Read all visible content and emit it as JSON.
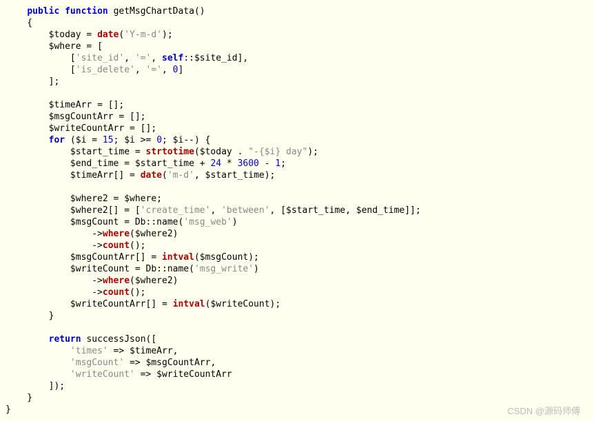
{
  "code": {
    "sig": {
      "public": "public",
      "function": "function",
      "name": "getMsgChartData"
    },
    "today": {
      "var": "$today",
      "date": "date",
      "fmt": "'Y-m-d'"
    },
    "whereAssign": {
      "var": "$where"
    },
    "whereRow1": {
      "k": "'site_id'",
      "op": "'='",
      "self": "self",
      "siteId": "$site_id"
    },
    "whereRow2": {
      "k": "'is_delete'",
      "op": "'='",
      "val": "0"
    },
    "init": {
      "timeArr": "$timeArr",
      "msgCountArr": "$msgCountArr",
      "writeCountArr": "$writeCountArr"
    },
    "for": {
      "kw": "for",
      "i": "$i",
      "start": "15",
      "zero": "0"
    },
    "startTimeLine": {
      "var": "$start_time",
      "strtotime": "strtotime",
      "today": "$today",
      "daystr": "\"-{$i} day\""
    },
    "endTimeLine": {
      "var": "$end_time",
      "start": "$start_time",
      "n24": "24",
      "n3600": "3600",
      "n1": "1"
    },
    "timeArrPush": {
      "arr": "$timeArr",
      "date": "date",
      "fmt": "'m-d'",
      "start": "$start_time"
    },
    "where2a": {
      "var": "$where2",
      "src": "$where"
    },
    "where2b": {
      "var": "$where2",
      "k": "'create_time'",
      "btw": "'between'",
      "start": "$start_time",
      "end": "$end_time"
    },
    "msgCount": {
      "var": "$msgCount",
      "db": "Db",
      "name": "name",
      "tbl": "'msg_web'",
      "where": "where",
      "w2": "$where2",
      "count": "count"
    },
    "msgPush": {
      "arr": "$msgCountArr",
      "intval": "intval",
      "v": "$msgCount"
    },
    "writeCount": {
      "var": "$writeCount",
      "db": "Db",
      "name": "name",
      "tbl": "'msg_write'",
      "where": "where",
      "w2": "$where2",
      "count": "count"
    },
    "writePush": {
      "arr": "$writeCountArr",
      "intval": "intval",
      "v": "$writeCount"
    },
    "ret": {
      "return": "return",
      "fn": "successJson",
      "times": "'times'",
      "timeArr": "$timeArr",
      "msgCountK": "'msgCount'",
      "msgCountArr": "$msgCountArr",
      "writeCountK": "'writeCount'",
      "writeCountArr": "$writeCountArr"
    }
  },
  "watermark": "CSDN @源码师傅"
}
